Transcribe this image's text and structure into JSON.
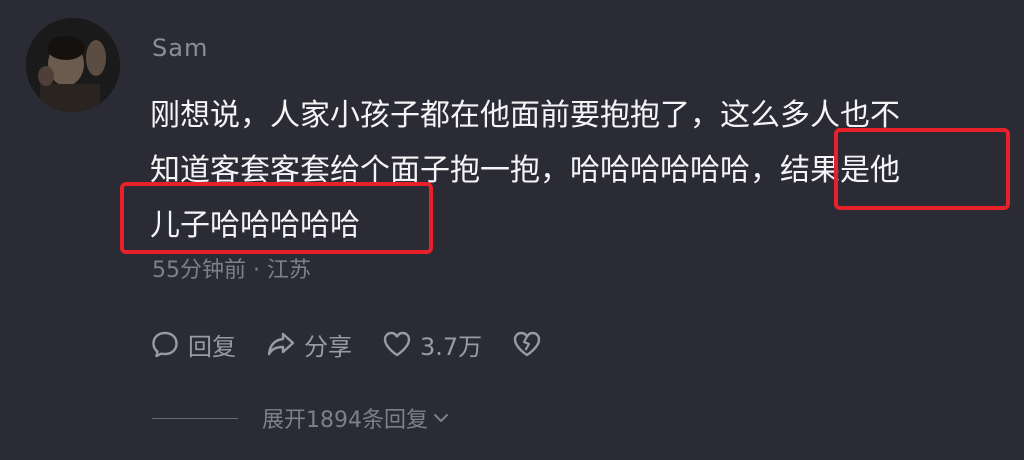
{
  "comment": {
    "author": "Sam",
    "lines": [
      "刚想说，人家小孩子都在他面前要抱抱了，这么多人也不",
      "知道客套客套给个面子抱一抱，哈哈哈哈哈哈，结果是他",
      "儿子哈哈哈哈哈"
    ],
    "meta": "55分钟前 · 江苏"
  },
  "actions": {
    "reply": "回复",
    "share": "分享",
    "likes": "3.7万"
  },
  "expand": {
    "label": "展开1894条回复"
  },
  "colors": {
    "background": "#2b2b36",
    "highlight": "#e8202a"
  }
}
